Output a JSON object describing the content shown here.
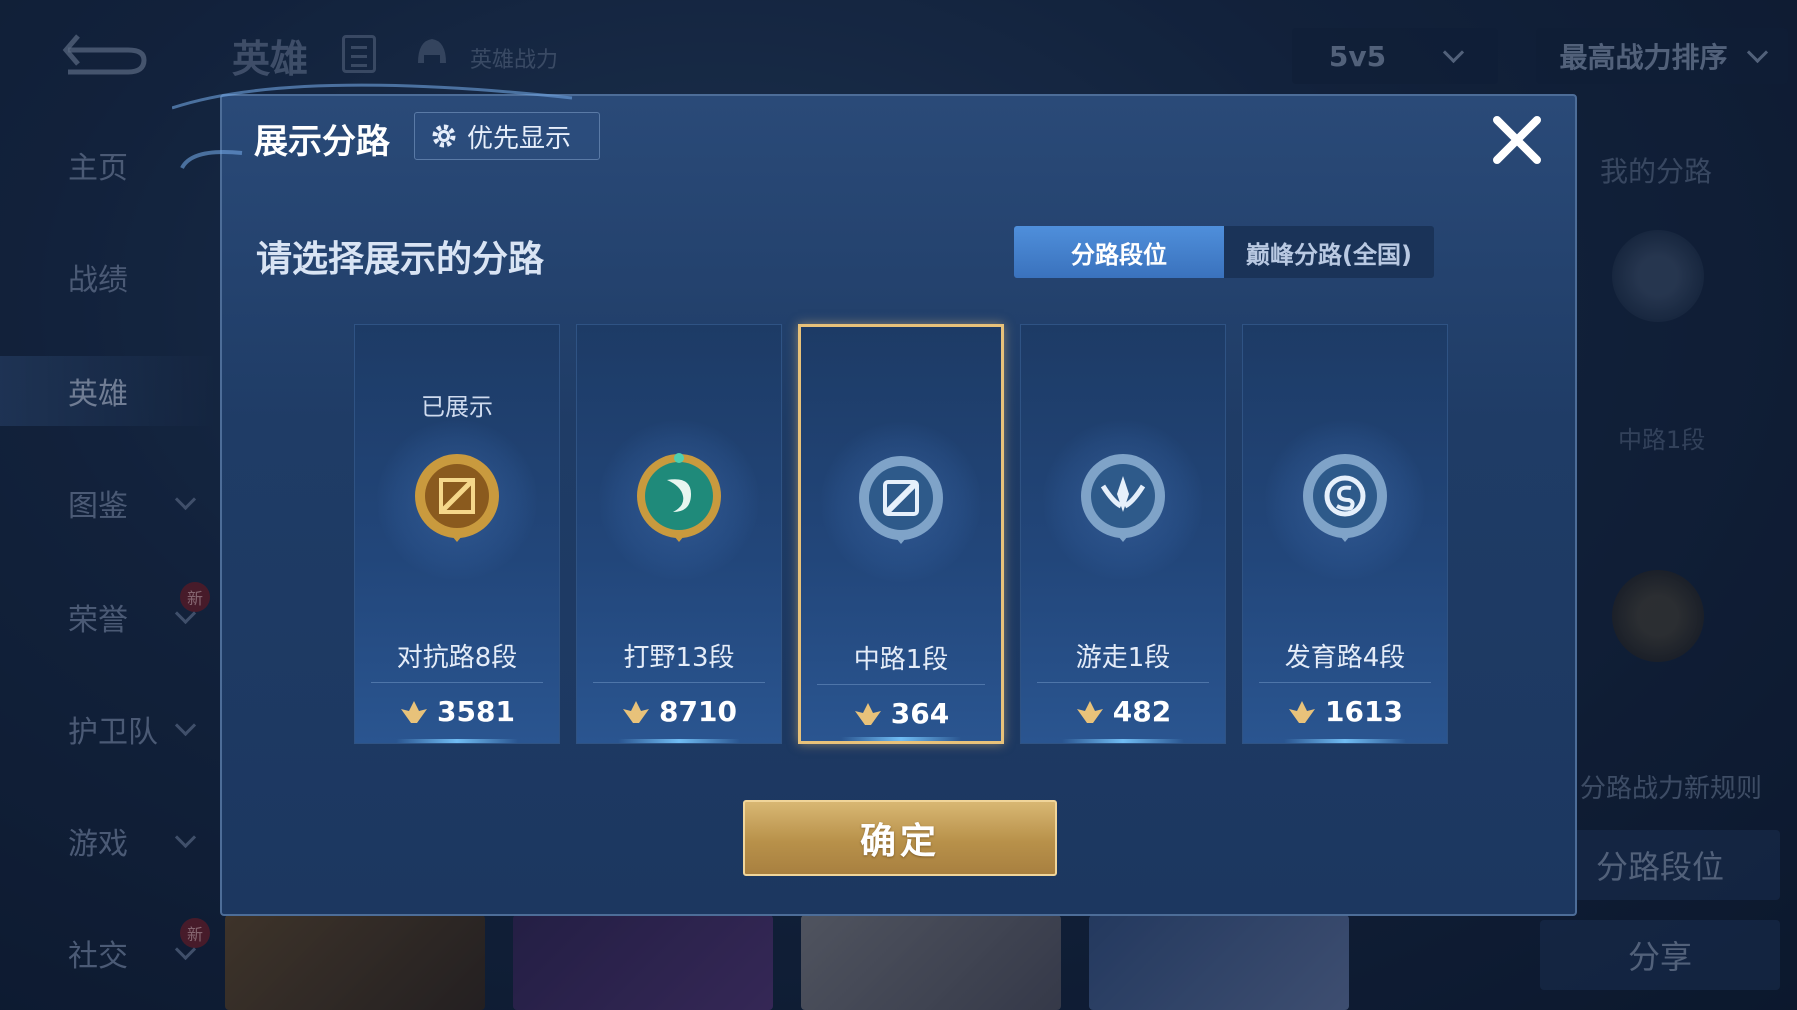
{
  "background": {
    "title": "英雄",
    "power_label": "英雄战力",
    "mode_select": "5v5",
    "sort_select": "最高战力排序",
    "sidebar": [
      {
        "label": "主页",
        "chevron": false,
        "new": false
      },
      {
        "label": "战绩",
        "chevron": false,
        "new": false
      },
      {
        "label": "英雄",
        "chevron": false,
        "new": false,
        "active": true
      },
      {
        "label": "图鉴",
        "chevron": true,
        "new": false
      },
      {
        "label": "荣誉",
        "chevron": true,
        "new": true
      },
      {
        "label": "护卫队",
        "chevron": true,
        "new": false
      },
      {
        "label": "游戏",
        "chevron": true,
        "new": false
      },
      {
        "label": "社交",
        "chevron": true,
        "new": true
      }
    ],
    "new_badge": "新",
    "right_panel": {
      "title": "我的分路",
      "rank": "中路1段",
      "rule_link": "分路战力新规则",
      "lane_rank_button": "分路段位",
      "share_button": "分享"
    }
  },
  "dialog": {
    "title": "展示分路",
    "priority_button": "优先显示",
    "subtitle": "请选择展示的分路",
    "tabs": [
      {
        "label": "分路段位",
        "active": true
      },
      {
        "label": "巅峰分路(全国)",
        "active": false
      }
    ],
    "cards": [
      {
        "status": "已展示",
        "rank": "对抗路8段",
        "power": "3581",
        "emblem": "clash-lane-emblem-icon",
        "color": "#c99a3e",
        "selected": false
      },
      {
        "status": "",
        "rank": "打野13段",
        "power": "8710",
        "emblem": "jungle-emblem-icon",
        "color": "#1f8a7a",
        "selected": false
      },
      {
        "status": "",
        "rank": "中路1段",
        "power": "364",
        "emblem": "mid-lane-emblem-icon",
        "color": "#7fa3c8",
        "selected": true
      },
      {
        "status": "",
        "rank": "游走1段",
        "power": "482",
        "emblem": "roam-emblem-icon",
        "color": "#7fa3c8",
        "selected": false
      },
      {
        "status": "",
        "rank": "发育路4段",
        "power": "1613",
        "emblem": "farm-lane-emblem-icon",
        "color": "#7fa3c8",
        "selected": false
      }
    ],
    "confirm_button": "确定"
  },
  "colors": {
    "accent_gold": "#e8c27a",
    "tab_active": "#4f8fdb",
    "dialog_bg": "#22426e"
  }
}
